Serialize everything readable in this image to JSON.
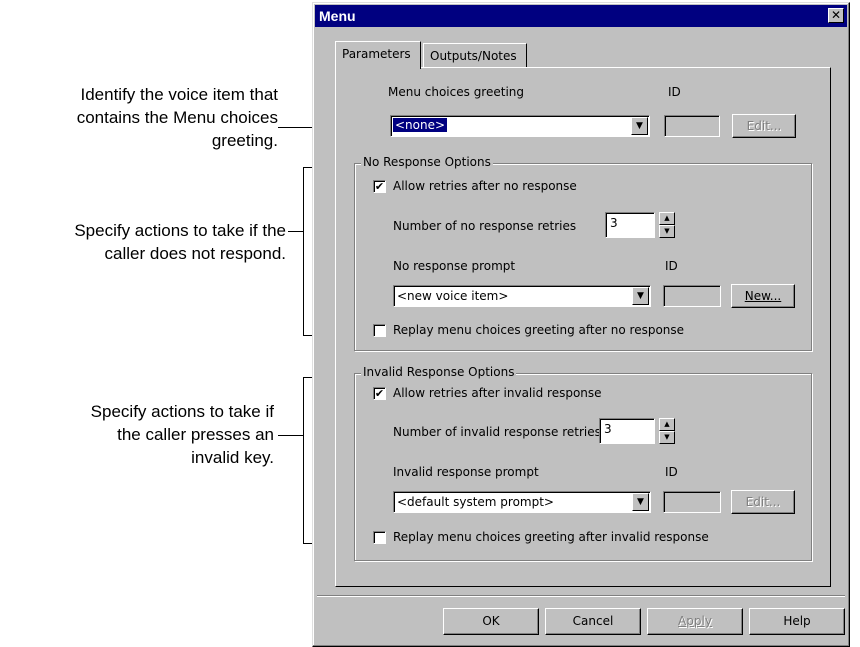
{
  "callouts": {
    "greeting": [
      "Identify the voice item that",
      "contains the Menu choices",
      "greeting."
    ],
    "no_response": [
      "Specify actions to take if the",
      "caller does not respond."
    ],
    "invalid": [
      "Specify actions to take if",
      "the caller presses an",
      "invalid key."
    ]
  },
  "dialog": {
    "title": "Menu",
    "close_glyph": "✕",
    "tabs": [
      "Parameters",
      "Outputs/Notes"
    ],
    "greeting": {
      "label": "Menu choices greeting",
      "id_label": "ID",
      "value": "<none>",
      "id_value": "",
      "edit_label": "Edit..."
    },
    "no_response": {
      "legend": "No Response Options",
      "allow_label": "Allow retries after no response",
      "allow_checked": true,
      "retries_label": "Number of no response retries",
      "retries_value": "3",
      "prompt_label": "No response prompt",
      "id_label": "ID",
      "prompt_value": "<new voice item>",
      "id_value": "",
      "new_label": "New...",
      "replay_label": "Replay menu choices greeting after no response",
      "replay_checked": false
    },
    "invalid_response": {
      "legend": "Invalid Response Options",
      "allow_label": "Allow retries after invalid response",
      "allow_checked": true,
      "retries_label": "Number of invalid response retries",
      "retries_value": "3",
      "prompt_label": "Invalid response prompt",
      "id_label": "ID",
      "prompt_value": "<default system prompt>",
      "id_value": "",
      "edit_label": "Edit...",
      "replay_label": "Replay menu choices greeting after invalid response",
      "replay_checked": false
    },
    "buttons": {
      "ok": "OK",
      "cancel": "Cancel",
      "apply": "Apply",
      "help": "Help"
    },
    "check_glyph": "✔",
    "dropdown_glyph": "▼",
    "spin_up_glyph": "▲",
    "spin_down_glyph": "▼"
  }
}
